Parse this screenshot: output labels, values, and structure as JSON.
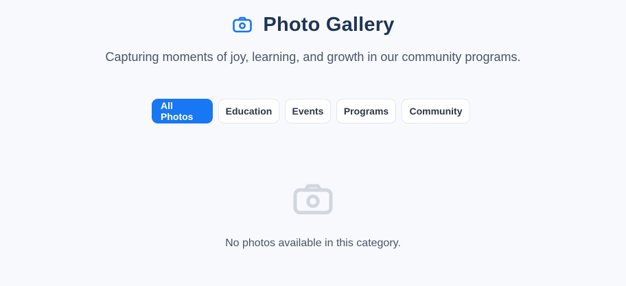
{
  "header": {
    "title": "Photo Gallery",
    "title_icon": "camera-icon",
    "subtitle": "Capturing moments of joy, learning, and growth in our community programs."
  },
  "filters": {
    "active": "All Photos",
    "items": [
      {
        "label": "All Photos"
      },
      {
        "label": "Education"
      },
      {
        "label": "Events"
      },
      {
        "label": "Programs"
      },
      {
        "label": "Community"
      }
    ]
  },
  "empty_state": {
    "icon": "camera-icon",
    "message": "No photos available in this category."
  },
  "colors": {
    "background": "#f7f9fc",
    "title": "#1f3556",
    "accent": "#1877f2",
    "muted_icon": "#d2d6dd",
    "text_muted": "#4a5568",
    "border": "#e2e8f0"
  }
}
